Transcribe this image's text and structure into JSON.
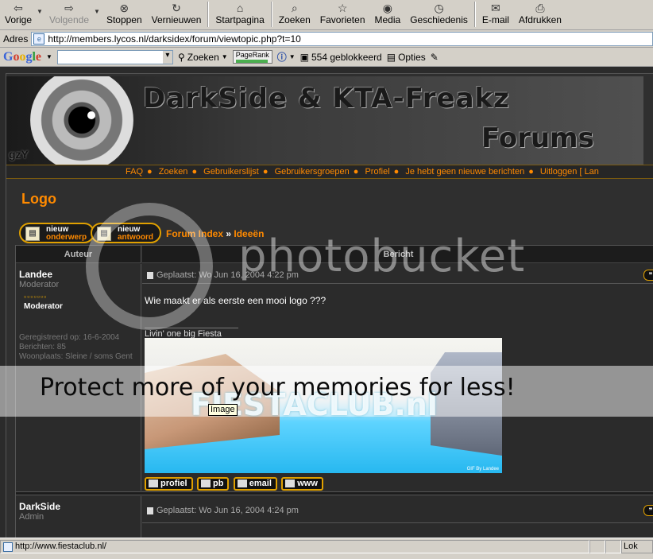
{
  "toolbar": {
    "back": "Vorige",
    "forward": "Volgende",
    "stop": "Stoppen",
    "refresh": "Vernieuwen",
    "home": "Startpagina",
    "search": "Zoeken",
    "favorites": "Favorieten",
    "media": "Media",
    "history": "Geschiedenis",
    "mail": "E-mail",
    "print": "Afdrukken"
  },
  "address": {
    "label": "Adres",
    "url": "http://members.lycos.nl/darksidex/forum/viewtopic.php?t=10"
  },
  "googlebar": {
    "logo": [
      "G",
      "o",
      "o",
      "g",
      "l",
      "e"
    ],
    "search_button": "Zoeken",
    "pagerank": "PageRank",
    "blocked": "554 geblokkeerd",
    "options": "Opties"
  },
  "banner": {
    "title": "DarkSide & KTA-Freakz",
    "subtitle": "Forums",
    "tag": "gzY"
  },
  "nav": {
    "items": [
      "FAQ",
      "Zoeken",
      "Gebruikerslijst",
      "Gebruikersgroepen",
      "Profiel",
      "Je hebt geen nieuwe berichten",
      "Uitloggen [ Lan"
    ]
  },
  "page_title": "Logo",
  "buttons": {
    "new_topic_top": "nieuw",
    "new_topic_sub": "onderwerp",
    "reply_top": "nieuw",
    "reply_sub": "antwoord"
  },
  "breadcrumb": {
    "index": "Forum Index",
    "sep": "»",
    "forum": "Ideeën"
  },
  "table": {
    "author_header": "Auteur",
    "message_header": "Bericht"
  },
  "posts": [
    {
      "author": "Landee",
      "rank": "Moderator",
      "stars": "▫▫▫▫▫▫▫",
      "level": "Moderator",
      "registered": "Geregistreerd op: 16-6-2004",
      "posts": "Berichten: 85",
      "location": "Woonplaats: Sleine / soms Gent",
      "posted": "Geplaatst: Wo Jun 16, 2004 4:22 pm",
      "body": "Wie maakt er als eerste een mooi logo ???",
      "signature": "Livin' one big Fiesta",
      "sig_credit": "GIF By Landee",
      "actions": [
        "profiel",
        "pb",
        "email",
        "www"
      ]
    },
    {
      "author": "DarkSide",
      "rank": "Admin",
      "posted": "Geplaatst: Wo Jun 16, 2004 4:24 pm"
    }
  ],
  "tooltip": "Image",
  "watermark": {
    "brand": "photobucket",
    "slogan": "Protect more of your memories for less!",
    "sig_text": "FIESTACLUB.nl"
  },
  "status": {
    "text": "http://www.fiestaclub.nl/",
    "zone": "Lok"
  }
}
